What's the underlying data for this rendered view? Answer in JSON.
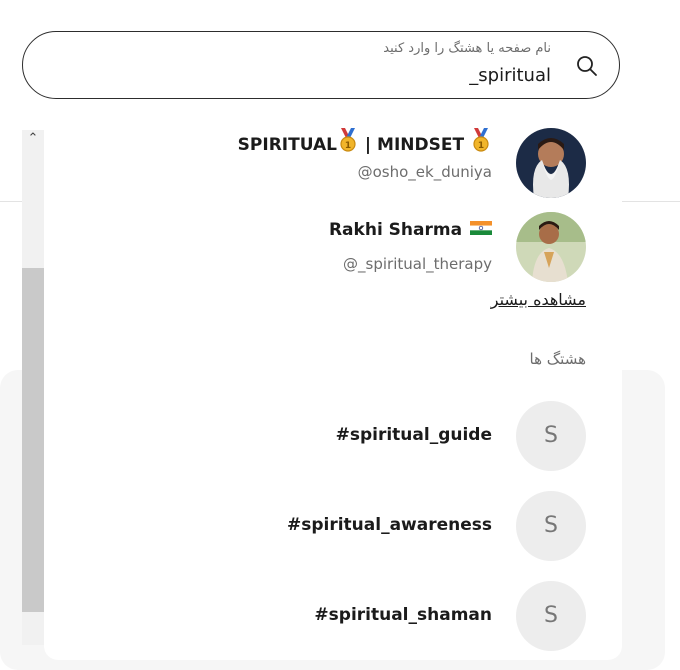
{
  "search": {
    "placeholder": "نام صفحه یا هشتگ را وارد کنید",
    "value": "_spiritual"
  },
  "results": {
    "accounts": [
      {
        "name_left": "SPIRITUAL",
        "name_mid": "| MINDSET",
        "handle": "@osho_ek_duniya",
        "avatar": "avatar-photo"
      },
      {
        "name_left": "Rakhi Sharma",
        "handle": "@_spiritual_therapy",
        "avatar": "avatar-photo"
      }
    ],
    "see_more": "مشاهده بیشتر",
    "hashtags_title": "هشتگ ها",
    "hashtags": [
      {
        "label": "#spiritual_guide",
        "initial": "S"
      },
      {
        "label": "#spiritual_awareness",
        "initial": "S"
      },
      {
        "label": "#spiritual_shaman",
        "initial": "S"
      }
    ]
  },
  "colors": {
    "text": "#1b1b1b",
    "muted": "#6d6d6d",
    "tag_circle": "#ededed",
    "border": "#2d2d2d"
  }
}
